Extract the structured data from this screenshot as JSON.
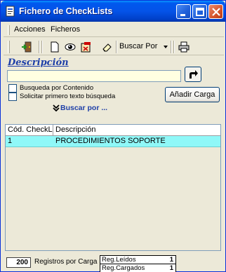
{
  "window": {
    "title": "Fichero de CheckLists"
  },
  "menu": {
    "items": [
      "Acciones",
      "Ficheros"
    ]
  },
  "toolbar": {
    "buscar_por_label": "Buscar Por"
  },
  "search": {
    "label": "Descripción",
    "value": "",
    "options": [
      "Busqueda por Contenido",
      "Solicitar primero texto búsqueda"
    ],
    "add_load_label": "Añadir Carga",
    "search_by_link": "Buscar por ..."
  },
  "grid": {
    "columns": [
      "Cód. CheckL",
      "Descripción"
    ],
    "rows": [
      {
        "code": "1",
        "description": "PROCEDIMIENTOS SOPORTE"
      }
    ]
  },
  "status": {
    "records_per_load": "200",
    "records_per_load_label": "Registros por Carga",
    "second_label": "...",
    "read_label": "Reg.Leídos",
    "read_value": "1",
    "loaded_label": "Reg.Cargados",
    "loaded_value": "1"
  },
  "colors": {
    "title_bar": "#0453E8",
    "selected_row": "#8FF8F8",
    "input_bg": "#FFFFE1"
  }
}
